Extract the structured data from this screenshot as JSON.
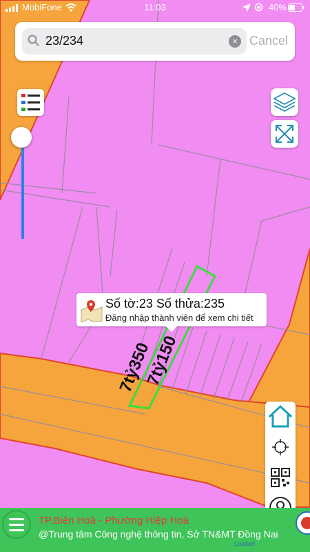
{
  "status_bar": {
    "carrier": "MobiFone",
    "time": "11:03",
    "battery": "40%"
  },
  "search": {
    "value": "23/234",
    "cancel_label": "Cancel"
  },
  "map": {
    "parcel_labels": [
      "7tỷ350",
      "7tỷ150"
    ],
    "popup": {
      "title": "Số tờ:23 Số thửa:235",
      "subtitle": "Đăng nhập thành viên để xem chi tiết"
    },
    "colors": {
      "residential": "#f18cf2",
      "road": "#f5a53b",
      "road_border": "#e0452a",
      "parcel_highlight": "#3cdc3c",
      "parcel_line": "#9a8aa0"
    }
  },
  "controls": {
    "legend_icon": "legend-list-icon",
    "layers_icon": "layers-icon",
    "fullscreen_icon": "expand-arrows-icon",
    "home_icon": "home-icon",
    "locate_icon": "crosshair-icon",
    "qr_icon": "qr-scan-icon",
    "user_icon": "user-icon"
  },
  "footer": {
    "location": "TP.Biên Hoà - Phường Hiệp Hoà",
    "credit": "@Trung tâm Công nghệ thông tin, Sở TN&MT Đồng Nai",
    "status": "Loaded"
  }
}
